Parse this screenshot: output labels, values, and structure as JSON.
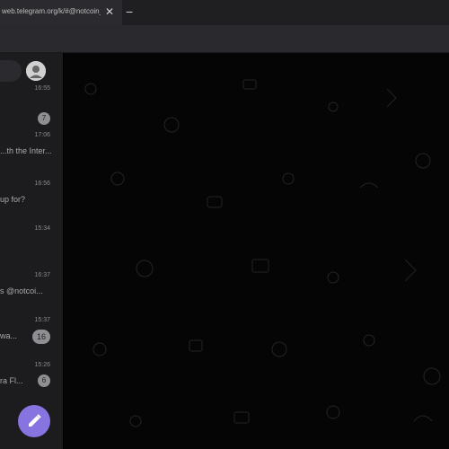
{
  "browser": {
    "tab_title": "web.telegram.org/k/#@notcoin_bot",
    "close_icon": "close-icon",
    "newtab_icon": "chevron-icon"
  },
  "sidebar": {
    "search_icon": "search-icon",
    "avatar_icon": "avatar-icon",
    "chats": [
      {
        "time": "16:55",
        "preview": "",
        "badge": "7"
      },
      {
        "time": "17:06",
        "preview": "...th the Inter...",
        "badge": ""
      },
      {
        "time": "16:56",
        "preview": "up for?",
        "badge": ""
      },
      {
        "time": "15:34",
        "preview": "",
        "badge": ""
      },
      {
        "time": "16:37",
        "preview": "s @notcoi...",
        "badge": ""
      },
      {
        "time": "15:37",
        "preview": "wa...",
        "badge": "16"
      },
      {
        "time": "15:26",
        "preview": "ra Fl...",
        "badge": "6"
      }
    ],
    "compose_icon": "pencil-icon"
  },
  "colors": {
    "accent": "#8774e1",
    "background": "#050505",
    "sidebar": "#1c1c1e"
  }
}
